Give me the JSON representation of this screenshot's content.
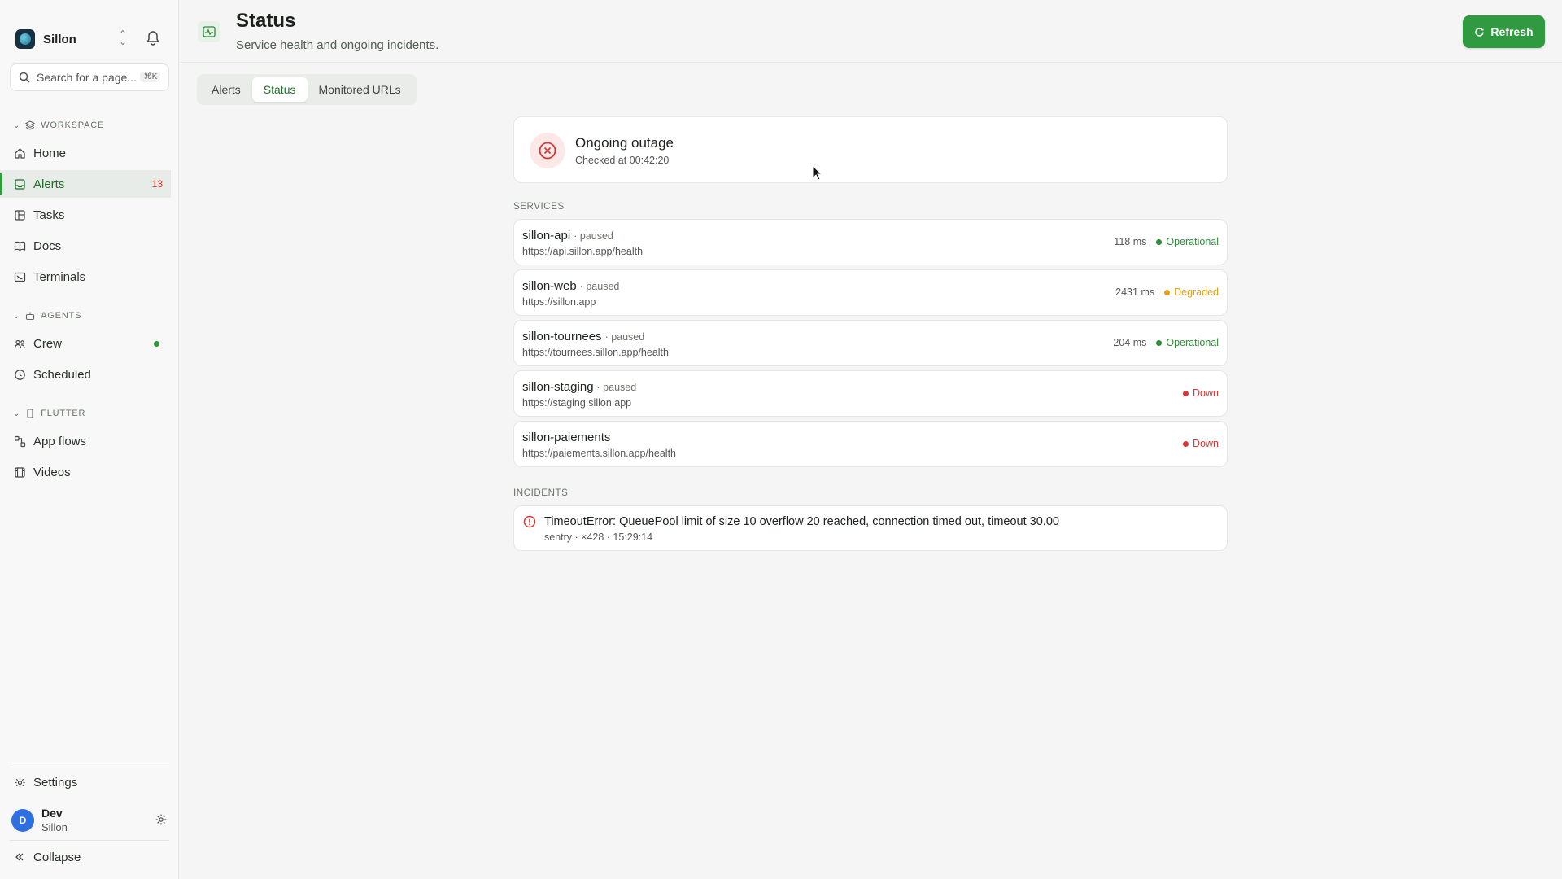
{
  "sidebar": {
    "workspace_name": "Sillon",
    "search_placeholder": "Search for a page...",
    "search_shortcut": "⌘K",
    "sections": {
      "workspace": "WORKSPACE",
      "agents": "AGENTS",
      "flutter": "FLUTTER"
    },
    "items": {
      "home": "Home",
      "alerts": "Alerts",
      "alerts_count": "13",
      "tasks": "Tasks",
      "docs": "Docs",
      "terminals": "Terminals",
      "crew": "Crew",
      "scheduled": "Scheduled",
      "app_flows": "App flows",
      "videos": "Videos"
    },
    "settings": "Settings",
    "user": {
      "initial": "D",
      "name": "Dev",
      "org": "Sillon"
    },
    "collapse": "Collapse"
  },
  "header": {
    "title": "Status",
    "subtitle": "Service health and ongoing incidents.",
    "refresh_label": "Refresh"
  },
  "tabs": [
    "Alerts",
    "Status",
    "Monitored URLs"
  ],
  "active_tab": "Status",
  "outage": {
    "title": "Ongoing outage",
    "checked": "Checked at 00:42:20"
  },
  "services_label": "SERVICES",
  "services": [
    {
      "name": "sillon-api",
      "state": "· paused",
      "url": "https://api.sillon.app/health",
      "ms": "118 ms",
      "status": "Operational"
    },
    {
      "name": "sillon-web",
      "state": "· paused",
      "url": "https://sillon.app",
      "ms": "2431 ms",
      "status": "Degraded"
    },
    {
      "name": "sillon-tournees",
      "state": "· paused",
      "url": "https://tournees.sillon.app/health",
      "ms": "204 ms",
      "status": "Operational"
    },
    {
      "name": "sillon-staging",
      "state": "· paused",
      "url": "https://staging.sillon.app",
      "ms": "",
      "status": "Down"
    },
    {
      "name": "sillon-paiements",
      "state": "",
      "url": "https://paiements.sillon.app/health",
      "ms": "",
      "status": "Down"
    }
  ],
  "incidents_label": "INCIDENTS",
  "incidents": [
    {
      "title": "TimeoutError: QueuePool limit of size 10 overflow 20 reached, connection timed out, timeout 30.00",
      "meta": "sentry · ×428 · 15:29:14"
    }
  ],
  "colors": {
    "accent": "#2f9a3f",
    "operational": "#2e8b3a",
    "degraded": "#e0a012",
    "down": "#d93636"
  }
}
